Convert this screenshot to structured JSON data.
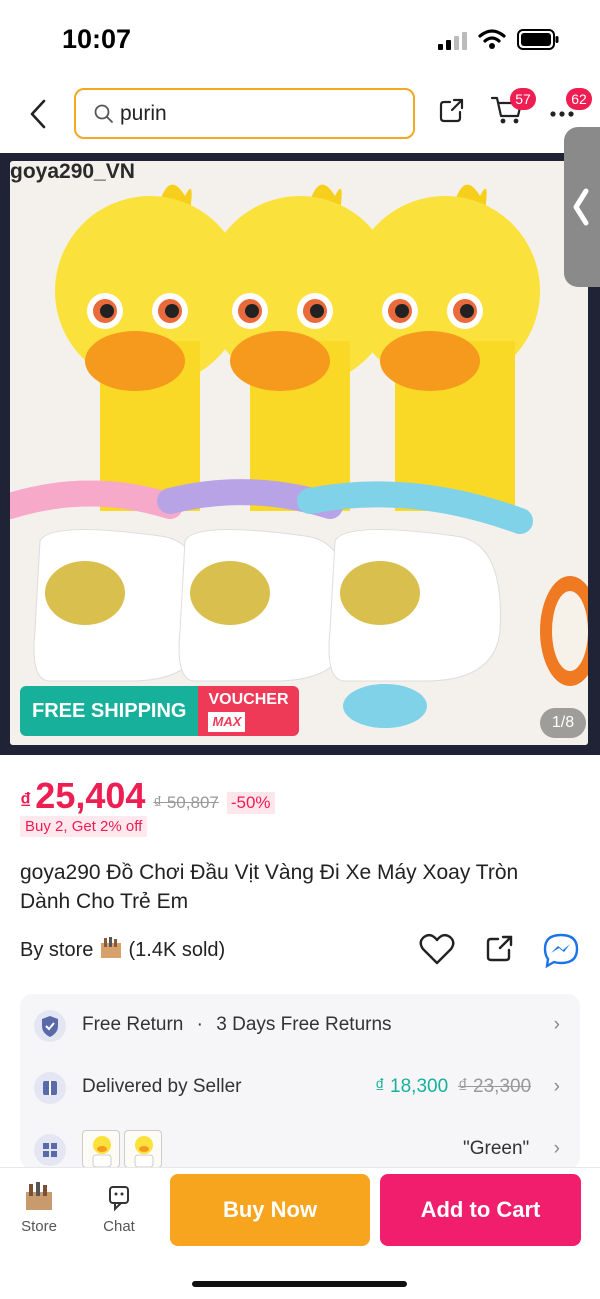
{
  "status_bar": {
    "time": "10:07"
  },
  "header": {
    "search_value": "purin",
    "cart_badge": "57",
    "more_badge": "62"
  },
  "product_image": {
    "seller_watermark": "goya290_VN",
    "free_shipping_label": "FREE SHIPPING",
    "voucher_label": "VOUCHER",
    "voucher_max_label": "MAX",
    "image_counter": "1/8"
  },
  "price": {
    "currency_symbol": "₫",
    "current": "25,404",
    "original": "₫ 50,807",
    "discount": "-50%",
    "promo": "Buy 2, Get 2% off"
  },
  "product": {
    "title": "goya290 Đồ Chơi Đầu Vịt Vàng Đi Xe Máy Xoay Tròn Dành Cho Trẻ Em",
    "store_prefix": "By store",
    "sold_count": "(1.4K sold)"
  },
  "info": {
    "return_label": "Free Return",
    "return_separator": "·",
    "return_value": "3 Days Free Returns",
    "delivery_label": "Delivered by Seller",
    "delivery_fee": "₫ 18,300",
    "delivery_fee_original": "₫ 23,300",
    "variant_selected": "\"Green\""
  },
  "bottom_bar": {
    "store_label": "Store",
    "chat_label": "Chat",
    "buy_now_label": "Buy Now",
    "add_to_cart_label": "Add to Cart"
  },
  "colors": {
    "accent_pink": "#ee1d52",
    "buy_now": "#f7a41e",
    "add_to_cart": "#f01e6c",
    "search_border": "#f5a623",
    "delivery_green": "#17b19b"
  }
}
